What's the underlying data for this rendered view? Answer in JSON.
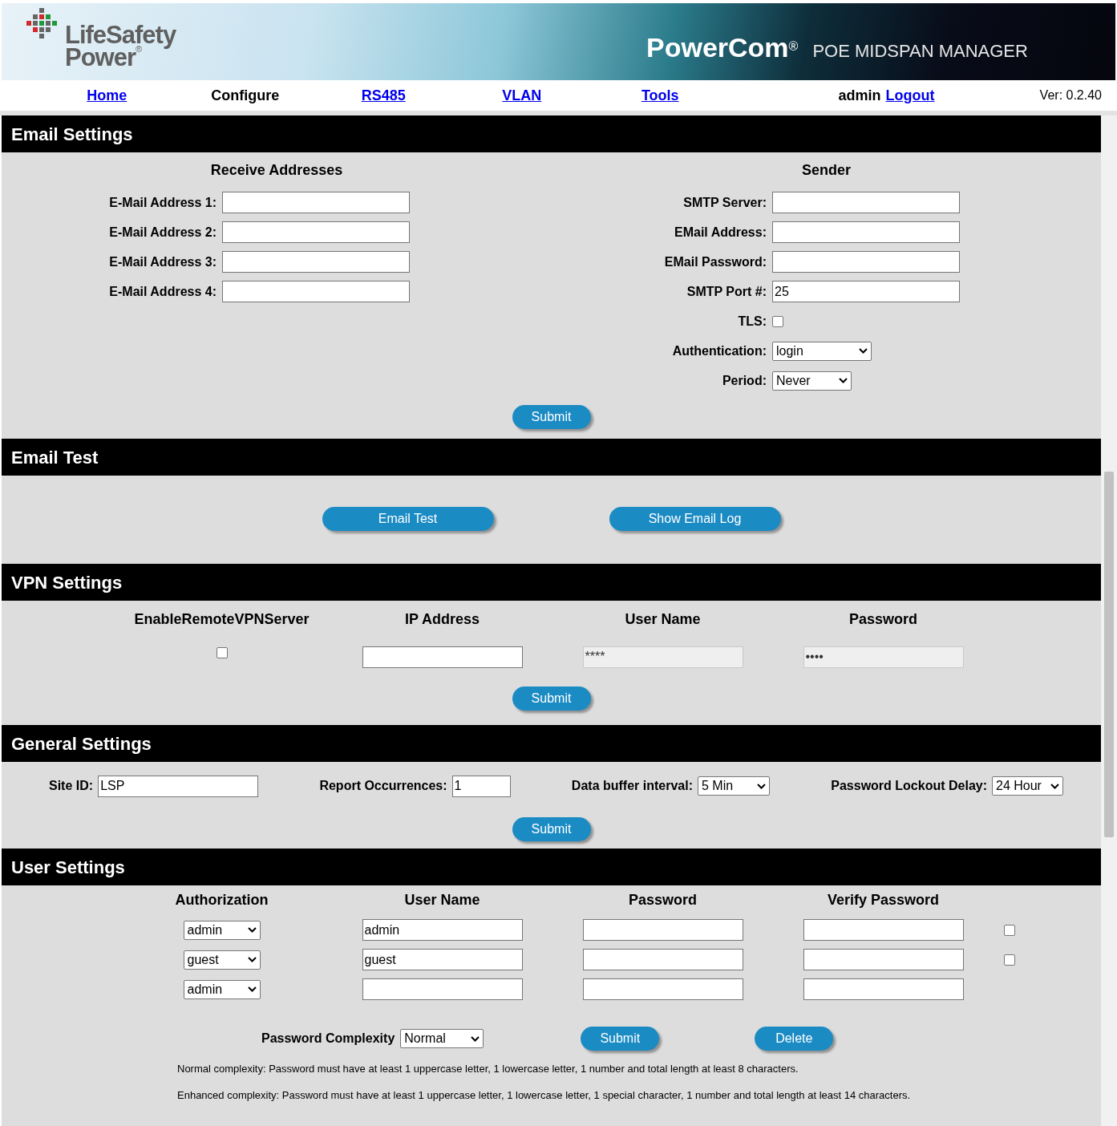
{
  "header": {
    "brand_top": "LifeSafety",
    "brand_bottom": "Power",
    "brand_mark": "®",
    "product": "PowerCom",
    "product_mark": "®",
    "subtitle": "POE MIDSPAN MANAGER"
  },
  "nav": {
    "items": [
      {
        "label": "Home",
        "selected": false
      },
      {
        "label": "Configure",
        "selected": true
      },
      {
        "label": "RS485",
        "selected": false
      },
      {
        "label": "VLAN",
        "selected": false
      },
      {
        "label": "Tools",
        "selected": false
      }
    ],
    "user": "admin",
    "logout": "Logout",
    "version": "Ver: 0.2.40"
  },
  "email_settings": {
    "title": "Email Settings",
    "receive_heading": "Receive Addresses",
    "sender_heading": "Sender",
    "receive_fields": [
      {
        "label": "E-Mail Address 1:"
      },
      {
        "label": "E-Mail Address 2:"
      },
      {
        "label": "E-Mail Address 3:"
      },
      {
        "label": "E-Mail Address 4:"
      }
    ],
    "sender_fields": [
      {
        "kind": "text",
        "label": "SMTP Server:"
      },
      {
        "kind": "text",
        "label": "EMail Address:"
      },
      {
        "kind": "text",
        "label": "EMail Password:"
      },
      {
        "kind": "text",
        "label": "SMTP Port #:",
        "value": "25"
      },
      {
        "kind": "checkbox",
        "label": "TLS:",
        "checked": false
      },
      {
        "kind": "select",
        "label": "Authentication:",
        "value": "login"
      },
      {
        "kind": "select",
        "label": "Period:",
        "value": "Never"
      }
    ],
    "submit": "Submit"
  },
  "email_test": {
    "title": "Email Test",
    "buttons": [
      "Email Test",
      "Show Email Log"
    ]
  },
  "vpn_settings": {
    "title": "VPN Settings",
    "columns": [
      "EnableRemoteVPNServer",
      "IP Address",
      "User Name",
      "Password"
    ],
    "enable_checked": false,
    "user_name": {
      "value": "****",
      "disabled": true
    },
    "password": {
      "value": "••••",
      "disabled": true
    },
    "submit": "Submit"
  },
  "general_settings": {
    "title": "General Settings",
    "fields": [
      {
        "kind": "text",
        "label": "Site ID:",
        "value": "LSP"
      },
      {
        "kind": "text",
        "label": "Report Occurrences:",
        "value": "1"
      },
      {
        "kind": "select",
        "label": "Data buffer interval:",
        "value": "5 Min"
      },
      {
        "kind": "select",
        "label": "Password Lockout Delay:",
        "value": "24 Hour"
      }
    ],
    "submit": "Submit"
  },
  "user_settings": {
    "title": "User Settings",
    "columns": [
      "Authorization",
      "User Name",
      "Password",
      "Verify Password"
    ],
    "rows": [
      {
        "authorization": "admin",
        "user_name": "admin",
        "checkbox": {
          "checked": false
        }
      },
      {
        "authorization": "guest",
        "user_name": "guest",
        "checkbox": {
          "checked": false
        }
      },
      {
        "authorization": "admin"
      }
    ],
    "complexity_label": "Password Complexity",
    "complexity_value": "Normal",
    "submit": "Submit",
    "delete": "Delete",
    "notes": [
      "Normal complexity: Password must have at least 1 uppercase letter, 1 lowercase letter, 1 number and total length at least 8 characters.",
      "Enhanced complexity: Password must have at least 1 uppercase letter, 1 lowercase letter, 1 special character, 1 number and total length at least 14 characters."
    ]
  }
}
